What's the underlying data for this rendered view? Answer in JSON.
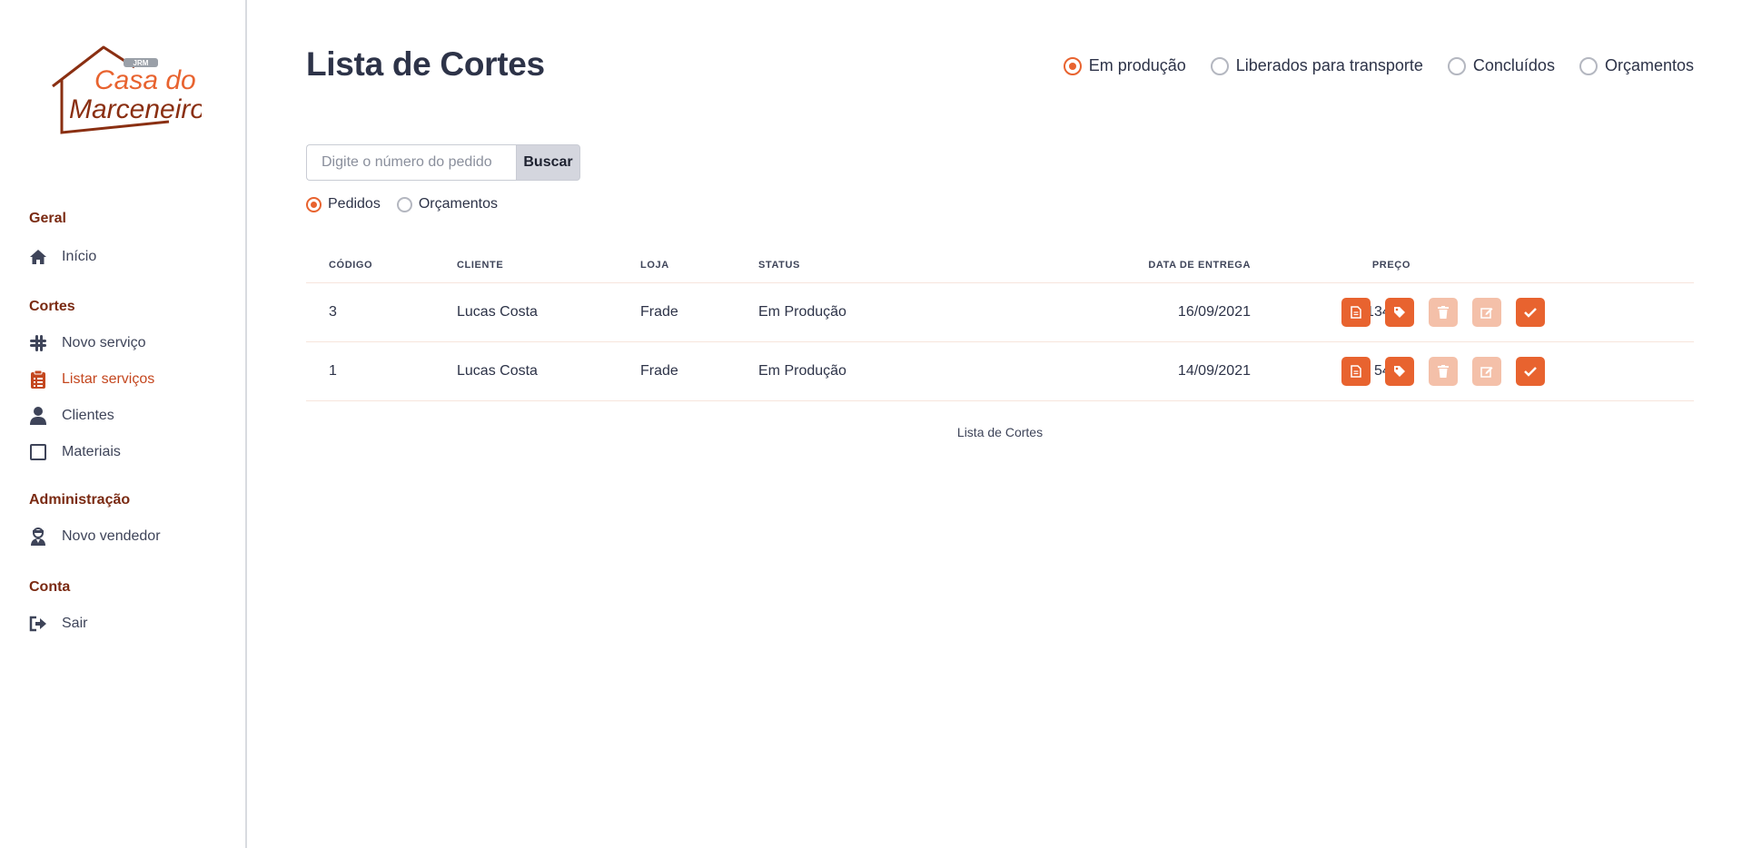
{
  "logo": {
    "small": "JRM",
    "line1": "Casa do",
    "line2": "Marceneiro"
  },
  "sidebar": {
    "sections": [
      {
        "title": "Geral",
        "items": [
          {
            "label": "Início",
            "icon": "home-icon"
          }
        ]
      },
      {
        "title": "Cortes",
        "items": [
          {
            "label": "Novo serviço",
            "icon": "slack-icon"
          },
          {
            "label": "Listar serviços",
            "icon": "clipboard-icon",
            "active": true
          },
          {
            "label": "Clientes",
            "icon": "user-icon"
          },
          {
            "label": "Materiais",
            "icon": "square-icon"
          }
        ]
      },
      {
        "title": "Administração",
        "items": [
          {
            "label": "Novo vendedor",
            "icon": "user-tie-icon"
          }
        ]
      },
      {
        "title": "Conta",
        "items": [
          {
            "label": "Sair",
            "icon": "sign-out-icon"
          }
        ]
      }
    ]
  },
  "page": {
    "title": "Lista de Cortes"
  },
  "status_filters": [
    {
      "label": "Em produção",
      "selected": true
    },
    {
      "label": "Liberados para transporte",
      "selected": false
    },
    {
      "label": "Concluídos",
      "selected": false
    },
    {
      "label": "Orçamentos",
      "selected": false
    }
  ],
  "search": {
    "placeholder": "Digite o número do pedido",
    "button": "Buscar",
    "value": ""
  },
  "type_filters": [
    {
      "label": "Pedidos",
      "selected": true
    },
    {
      "label": "Orçamentos",
      "selected": false
    }
  ],
  "table": {
    "headers": {
      "code": "CÓDIGO",
      "client": "CLIENTE",
      "store": "LOJA",
      "status": "STATUS",
      "delivery": "DATA DE ENTREGA",
      "price": "PREÇO"
    },
    "rows": [
      {
        "code": "3",
        "client": "Lucas Costa",
        "store": "Frade",
        "status": "Em Produção",
        "delivery": "16/09/2021",
        "price": "R$ 134,00"
      },
      {
        "code": "1",
        "client": "Lucas Costa",
        "store": "Frade",
        "status": "Em Produção",
        "delivery": "14/09/2021",
        "price": "R$ 54,00"
      }
    ],
    "caption": "Lista de Cortes"
  },
  "colors": {
    "accent": "#e8632f",
    "accent_dim": "#f4c0a9",
    "section": "#7a2a12",
    "active_nav": "#c4471f"
  }
}
